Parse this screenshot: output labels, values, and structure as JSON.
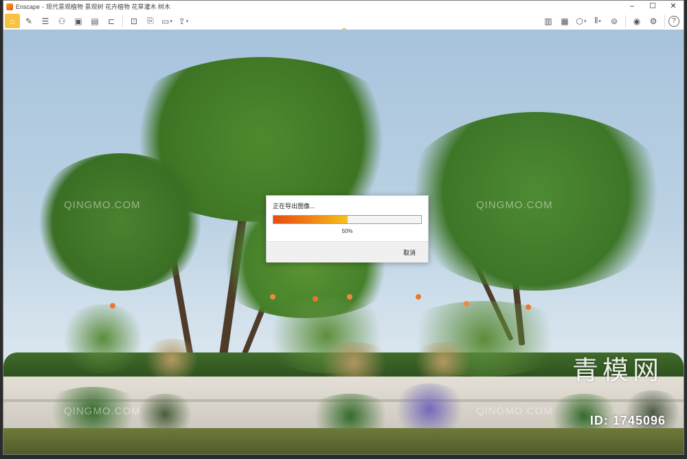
{
  "window": {
    "app_name": "Enscape",
    "title": "现代景观植物 景观树 花卉植物 花草灌木 树木",
    "controls": {
      "minimize": "–",
      "maximize": "☐",
      "close": "✕"
    }
  },
  "toolbar": {
    "left_icons": [
      "home-icon",
      "brush-icon",
      "text-lines-icon",
      "binoculars-icon",
      "image-icon",
      "box-icon",
      "chair-icon",
      "screenshot-icon",
      "export-icon",
      "video-icon",
      "share-icon"
    ],
    "collapse_symbol": "︿",
    "right_icons": [
      "map-icon",
      "monitor-icon",
      "cube-icon",
      "library-icon",
      "vr-headset-icon",
      "eye-icon",
      "settings-icon",
      "help-icon"
    ],
    "help_label": "?"
  },
  "dialog": {
    "title": "正在导出图像...",
    "progress_text": "50%",
    "progress_value": 0.5,
    "cancel_label": "取消"
  },
  "watermarks": {
    "text": "QINGMO.COM",
    "brand": "青模网",
    "id_text": "ID: 1745096"
  }
}
